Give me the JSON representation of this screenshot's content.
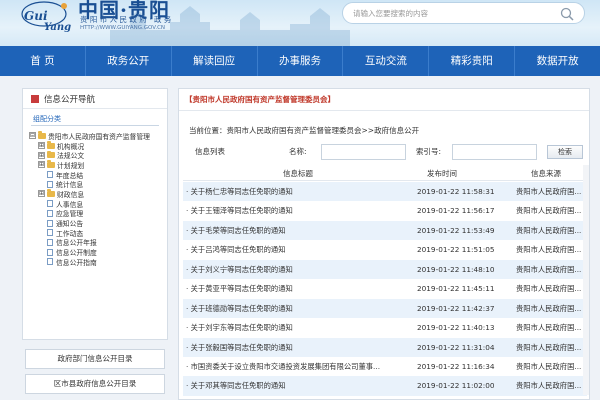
{
  "header": {
    "logo_text": "Gui Yang",
    "title": "中国·贵阳",
    "subtitle": "贵 阳 市 人 民 政 府 · 政 务",
    "url": "HTTP://WWW.GUIYANG.GOV.CN",
    "search_placeholder": "请输入您要搜索的内容"
  },
  "nav": {
    "items": [
      "首 页",
      "政务公开",
      "解读回应",
      "办事服务",
      "互动交流",
      "精彩贵阳",
      "数据开放"
    ]
  },
  "sidebar": {
    "title": "信息公开导航",
    "tab": "组配分类",
    "tree": [
      {
        "label": "贵阳市人民政府国有资产监督管理",
        "level": 0,
        "type": "folder",
        "toggle": "⊟"
      },
      {
        "label": "机构概况",
        "level": 1,
        "type": "folder",
        "toggle": "⊞"
      },
      {
        "label": "法规公文",
        "level": 1,
        "type": "folder",
        "toggle": "⊞"
      },
      {
        "label": "计划规划",
        "level": 1,
        "type": "folder",
        "toggle": "⊞"
      },
      {
        "label": "年度总结",
        "level": 1,
        "type": "doc"
      },
      {
        "label": "统计信息",
        "level": 1,
        "type": "doc"
      },
      {
        "label": "财政信息",
        "level": 1,
        "type": "folder",
        "toggle": "⊞"
      },
      {
        "label": "人事信息",
        "level": 1,
        "type": "doc"
      },
      {
        "label": "应急管理",
        "level": 1,
        "type": "doc"
      },
      {
        "label": "通知公告",
        "level": 1,
        "type": "doc"
      },
      {
        "label": "工作动态",
        "level": 1,
        "type": "doc"
      },
      {
        "label": "信息公开年报",
        "level": 1,
        "type": "doc"
      },
      {
        "label": "信息公开制度",
        "level": 1,
        "type": "doc"
      },
      {
        "label": "信息公开指南",
        "level": 1,
        "type": "doc"
      }
    ],
    "buttons": [
      "政府部门信息公开目录",
      "区市县政府信息公开目录"
    ]
  },
  "main": {
    "heading": "【贵阳市人民政府国有资产监督管理委员会】",
    "breadcrumb": "当前位置：贵阳市人民政府国有资产监督管理委员会>>政府信息公开",
    "filter": {
      "list_label": "信息列表",
      "name_label": "名称:",
      "index_label": "索引号:",
      "search_button": "检索"
    },
    "columns": {
      "title": "信息标题",
      "time": "发布时间",
      "source": "信息来源"
    },
    "rows": [
      {
        "title": "· 关于杨仁忠等同志任免职的通知",
        "time": "2019-01-22 11:58:31",
        "source": "贵阳市人民政府国..."
      },
      {
        "title": "· 关于王钿泽等同志任免职的通知",
        "time": "2019-01-22 11:56:17",
        "source": "贵阳市人民政府国..."
      },
      {
        "title": "· 关于毛荣等同志任免职的通知",
        "time": "2019-01-22 11:53:49",
        "source": "贵阳市人民政府国..."
      },
      {
        "title": "· 关于吕鸿等同志任免职的通知",
        "time": "2019-01-22 11:51:05",
        "source": "贵阳市人民政府国..."
      },
      {
        "title": "· 关于刘义宁等同志任免职的通知",
        "time": "2019-01-22 11:48:10",
        "source": "贵阳市人民政府国..."
      },
      {
        "title": "· 关于黄亚平等同志任免职的通知",
        "time": "2019-01-22 11:45:11",
        "source": "贵阳市人民政府国..."
      },
      {
        "title": "· 关于班德勋等同志任免职的通知",
        "time": "2019-01-22 11:42:37",
        "source": "贵阳市人民政府国..."
      },
      {
        "title": "· 关于刘宇东等同志任免职的通知",
        "time": "2019-01-22 11:40:13",
        "source": "贵阳市人民政府国..."
      },
      {
        "title": "· 关于张毅国等同志任免职的通知",
        "time": "2019-01-22 11:31:04",
        "source": "贵阳市人民政府国..."
      },
      {
        "title": "· 市国资委关于设立贵阳市交通投资发展集团有限公司董事...",
        "time": "2019-01-22 11:16:34",
        "source": "贵阳市人民政府国..."
      },
      {
        "title": "· 关于邓其等同志任免职的通知",
        "time": "2019-01-22 11:02:00",
        "source": "贵阳市人民政府国..."
      }
    ]
  },
  "colors": {
    "nav_bg": "#1e63b8",
    "heading_red": "#c0392b",
    "row_stripe": "#e9f2fb"
  }
}
